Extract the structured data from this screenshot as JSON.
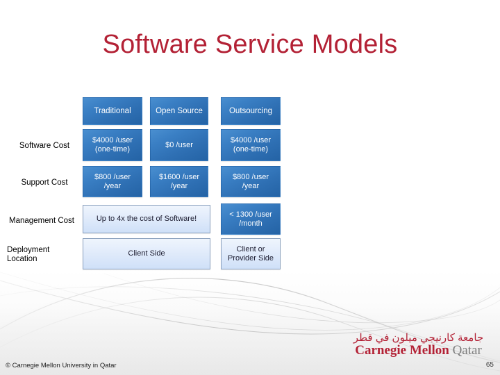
{
  "slide": {
    "title": "Software Service Models",
    "title_color": "#b32135",
    "page_number": "65",
    "footer": "© Carnegie Mellon University in Qatar"
  },
  "logo": {
    "arabic": "جامعة كارنيجي ميلون في قطر",
    "latin_primary": "Carnegie Mellon ",
    "latin_secondary": "Qatar",
    "color": "#b32135"
  },
  "table": {
    "corner_label": "",
    "columns": [
      {
        "label": "Traditional"
      },
      {
        "label": "Open Source"
      },
      {
        "label": "Outsourcing"
      }
    ],
    "rows": [
      {
        "label": "Software Cost",
        "cells": [
          {
            "text": "$4000 /user\n(one-time)",
            "style": "dark",
            "span": 1
          },
          {
            "text": "$0 /user",
            "style": "dark",
            "span": 1
          },
          {
            "text": "$4000 /user\n(one-time)",
            "style": "dark",
            "span": 1
          }
        ]
      },
      {
        "label": "Support Cost",
        "cells": [
          {
            "text": "$800 /user\n/year",
            "style": "dark",
            "span": 1
          },
          {
            "text": "$1600 /user\n/year",
            "style": "dark",
            "span": 1
          },
          {
            "text": "$800 /user\n/year",
            "style": "dark",
            "span": 1
          }
        ]
      },
      {
        "label": "Management Cost",
        "cells": [
          {
            "text": "Up to 4x the cost of Software!",
            "style": "light",
            "span": 2
          },
          {
            "text": "< 1300 /user\n/month",
            "style": "dark",
            "span": 1
          }
        ]
      },
      {
        "label": "Deployment\nLocation",
        "cells": [
          {
            "text": "Client Side",
            "style": "light",
            "span": 2
          },
          {
            "text": "Client or\nProvider Side",
            "style": "light",
            "span": 1
          }
        ]
      }
    ]
  }
}
